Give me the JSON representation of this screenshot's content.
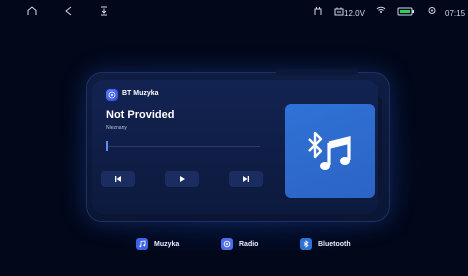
{
  "status": {
    "voltage": "12.0V",
    "time": "07:15"
  },
  "player": {
    "app_name": "BT Muzyka",
    "track_title": "Not Provided",
    "artist": "Nieznany",
    "progress": 0.0
  },
  "nav": {
    "items": [
      {
        "label": "Muzyka",
        "icon": "music-note-icon"
      },
      {
        "label": "Radio",
        "icon": "radio-icon"
      },
      {
        "label": "Bluetooth",
        "icon": "bluetooth-icon"
      }
    ]
  },
  "colors": {
    "background": "#02081a",
    "accent": "#2f72d6",
    "card": "#132351"
  }
}
